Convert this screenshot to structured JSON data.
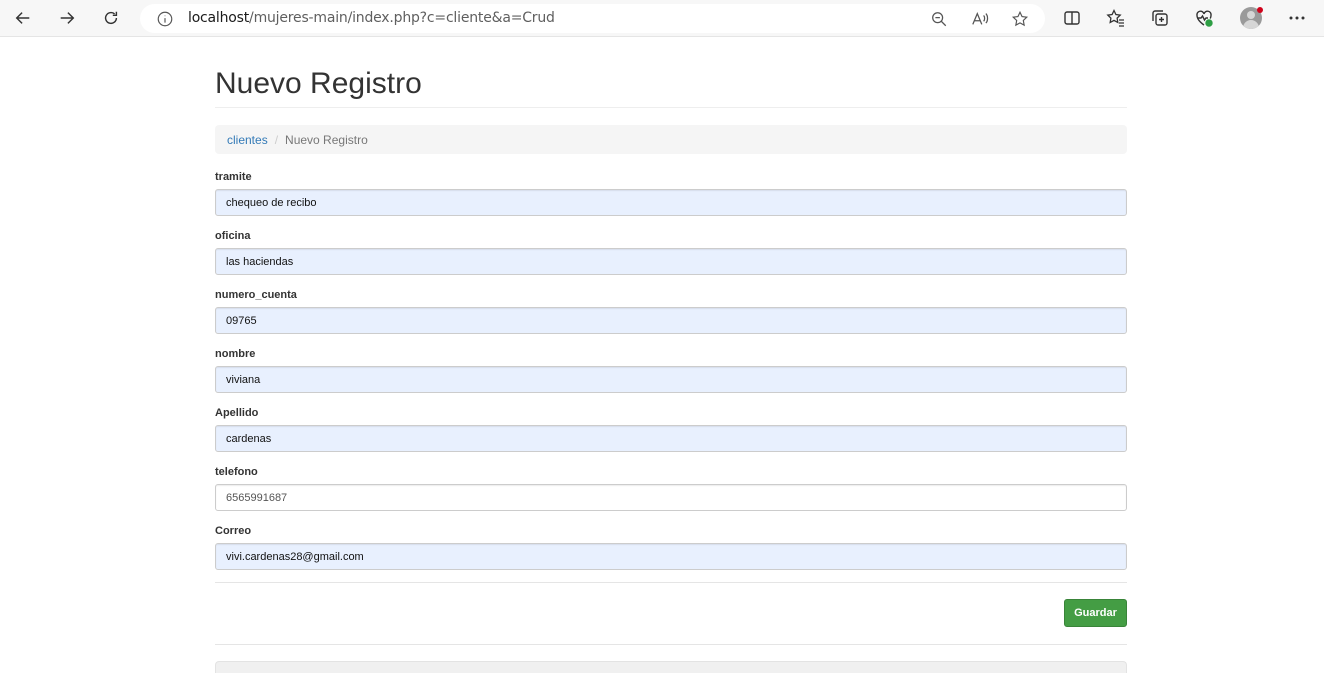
{
  "browser": {
    "url_host": "localhost",
    "url_path": "/mujeres-main/index.php?c=cliente&a=Crud",
    "icons": [
      "back-arrow-icon",
      "forward-arrow-icon",
      "refresh-icon",
      "info-icon",
      "zoom-out-icon",
      "read-aloud-icon",
      "favorite-star-icon",
      "split-screen-icon",
      "favorites-icon",
      "collections-icon",
      "browser-essentials-icon",
      "profile-avatar",
      "more-menu-icon"
    ]
  },
  "page": {
    "title": "Nuevo Registro",
    "breadcrumb": {
      "link": "clientes",
      "separator": "/",
      "current": "Nuevo Registro"
    }
  },
  "form": {
    "fields": [
      {
        "label": "tramite",
        "value": "chequeo de recibo"
      },
      {
        "label": "oficina",
        "value": "las haciendas"
      },
      {
        "label": "numero_cuenta",
        "value": "09765"
      },
      {
        "label": "nombre",
        "value": "viviana"
      },
      {
        "label": "Apellido",
        "value": "cardenas"
      },
      {
        "label": "telefono",
        "value": "6565991687"
      },
      {
        "label": "Correo",
        "value": "vivi.cardenas28@gmail.com"
      }
    ],
    "submit_label": "Guardar"
  },
  "colors": {
    "link": "#337ab7",
    "autofill_bg": "#e8f0fe",
    "success": "#449d44"
  }
}
